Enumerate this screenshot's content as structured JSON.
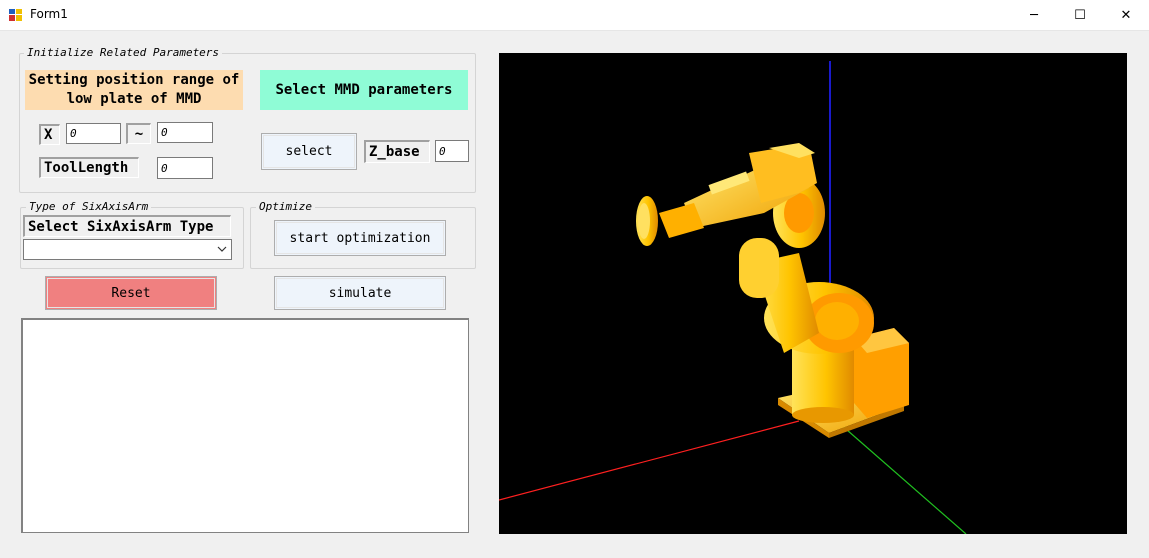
{
  "window": {
    "title": "Form1",
    "controls": {
      "minimize": "─",
      "maximize": "☐",
      "close": "✕"
    }
  },
  "init_group": {
    "label": "Initialize Related Parameters",
    "position_banner": "Setting position range of low plate of MMD",
    "mmd_banner": "Select MMD parameters",
    "x_label": "X",
    "x_min": "0",
    "tilde": "~",
    "x_max": "0",
    "tool_length_label": "ToolLength",
    "tool_length": "0",
    "select_button": "select",
    "z_base_label": "Z_base",
    "z_base": "0"
  },
  "type_group": {
    "label": "Type of SixAxisArm",
    "header": "Select SixAxisArm Type",
    "selected": ""
  },
  "optimize_group": {
    "label": "Optimize",
    "start_button": "start optimization"
  },
  "reset_button": "Reset",
  "simulate_button": "simulate",
  "log_text": "",
  "colors": {
    "position_banner_bg": "#fddcb0",
    "mmd_banner_bg": "#8ffcd6",
    "reset_bg": "#f08080",
    "viewport_bg": "#000000",
    "robot": "#ffb400",
    "axis_x": "#ff2020",
    "axis_y": "#20c020",
    "axis_z": "#2020ff"
  }
}
